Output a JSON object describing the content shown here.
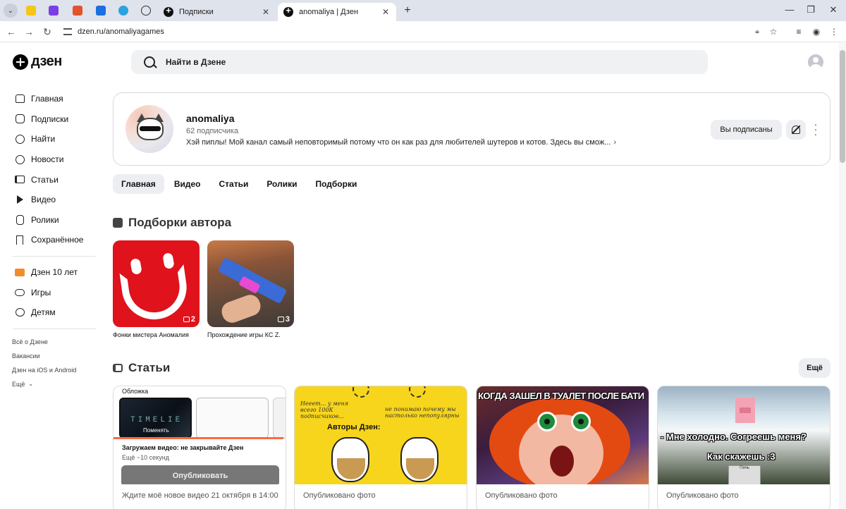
{
  "browser": {
    "tabs": [
      {
        "label": "Подписки",
        "active": false
      },
      {
        "label": "anomaliya | Дзен",
        "active": true
      }
    ],
    "url": "dzen.ru/anomaliyagames"
  },
  "header": {
    "logo_text": "дзен",
    "search_placeholder": "Найти в Дзене"
  },
  "sidebar": {
    "items": [
      {
        "label": "Главная",
        "icon": "home-icon"
      },
      {
        "label": "Подписки",
        "icon": "subscriptions-icon"
      },
      {
        "label": "Найти",
        "icon": "search-icon"
      },
      {
        "label": "Новости",
        "icon": "news-icon"
      },
      {
        "label": "Статьи",
        "icon": "articles-icon"
      },
      {
        "label": "Видео",
        "icon": "video-icon"
      },
      {
        "label": "Ролики",
        "icon": "shorts-icon"
      },
      {
        "label": "Сохранённое",
        "icon": "bookmark-icon"
      }
    ],
    "extra": [
      {
        "label": "Дзен 10 лет",
        "icon": "cake-icon"
      },
      {
        "label": "Игры",
        "icon": "gamepad-icon"
      },
      {
        "label": "Детям",
        "icon": "bear-icon"
      }
    ],
    "links": [
      "Всё о Дзене",
      "Вакансии",
      "Дзен на iOS и Android",
      "Ещё"
    ]
  },
  "channel": {
    "name": "anomaliya",
    "subscribers": "62 подписчика",
    "description": "Хэй пиплы! Мой канал самый неповторимый потому что он как раз для любителей шутеров и котов. Здесь вы смож...",
    "subscribed_label": "Вы подписаны"
  },
  "channel_tabs": [
    "Главная",
    "Видео",
    "Статьи",
    "Ролики",
    "Подборки"
  ],
  "collections": {
    "title": "Подборки автора",
    "items": [
      {
        "title": "Фонки мистера Аномалия",
        "count": "2"
      },
      {
        "title": "Прохождение игры КС Z.",
        "count": "3"
      }
    ]
  },
  "articles": {
    "title": "Статьи",
    "more_label": "Ещё",
    "cards": [
      {
        "caption": "Ждите моё новое видео 21 октября в 14:00",
        "image_texts": {
          "cover": "Обложка",
          "change": "Поменять",
          "timeline": "TIMELIE",
          "loading": "Загружаем видео: не закрывайте Дзен",
          "seconds": "Ещё ~10 секунд",
          "publish": "Опубликовать"
        }
      },
      {
        "caption": "Опубликовано фото",
        "image_texts": {
          "left": "Нееет... у меня всего 100К подписчиков...",
          "right": "не понимаю почему мы настолько непопулярны",
          "center": "Авторы Дзен:"
        }
      },
      {
        "caption": "Опубликовано фото",
        "image_texts": {
          "top": "КОГДА ЗАШЕЛ В ТУАЛЕТ ПОСЛЕ БАТИ"
        }
      },
      {
        "caption": "Опубликовано фото",
        "image_texts": {
          "line1": "- Мне холодно. Согреешь меня?",
          "line2": "Как скажешь :3",
          "block": "Печь"
        }
      }
    ]
  }
}
